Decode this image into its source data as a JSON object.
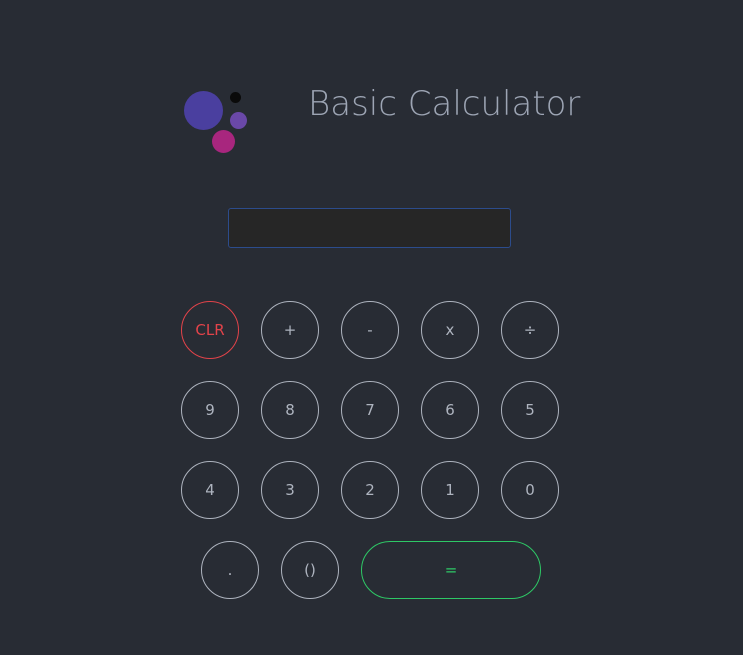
{
  "app": {
    "title": "Basic Calculator"
  },
  "colors": {
    "background": "#282c34",
    "title_text": "#9da5b4",
    "key_text": "#aeb4bf",
    "key_border": "#aeb4bf",
    "clear_accent": "#e2434a",
    "equals_accent": "#2ec866",
    "display_bg": "#262626",
    "display_border": "#2c4c8c",
    "logo_big": "#4a3f9f",
    "logo_black": "#0a0a0a",
    "logo_medium": "#6a48a8",
    "logo_pink": "#a8267e"
  },
  "logo": {
    "icon": "logo-bubbles-icon"
  },
  "display": {
    "value": ""
  },
  "keys": {
    "clear": "CLR",
    "plus": "+",
    "minus": "-",
    "multiply": "x",
    "divide": "÷",
    "nine": "9",
    "eight": "8",
    "seven": "7",
    "six": "6",
    "five": "5",
    "four": "4",
    "three": "3",
    "two": "2",
    "one": "1",
    "zero": "0",
    "decimal": ".",
    "parens": "()",
    "equals": "="
  }
}
